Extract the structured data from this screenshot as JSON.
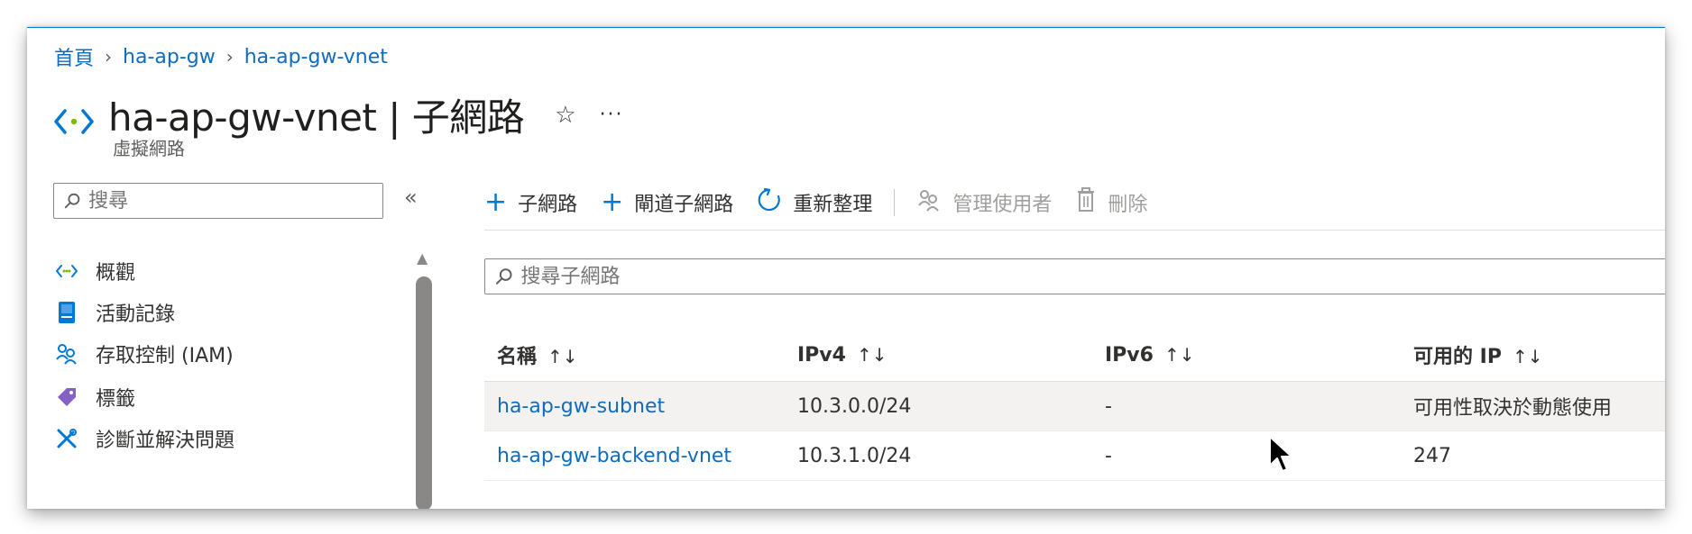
{
  "breadcrumb": {
    "home": "首頁",
    "parent": "ha-ap-gw",
    "current": "ha-ap-gw-vnet"
  },
  "header": {
    "title": "ha-ap-gw-vnet | 子網路",
    "subtitle": "虛擬網路",
    "favorite_icon": "☆",
    "more_icon": "···"
  },
  "sidebar": {
    "search_placeholder": "搜尋",
    "collapse_icon": "«",
    "items": [
      {
        "label": "概觀",
        "icon": "vnet-icon"
      },
      {
        "label": "活動記錄",
        "icon": "activity-log-icon"
      },
      {
        "label": "存取控制 (IAM)",
        "icon": "iam-icon"
      },
      {
        "label": "標籤",
        "icon": "tag-icon"
      },
      {
        "label": "診斷並解決問題",
        "icon": "diagnose-icon"
      }
    ]
  },
  "toolbar": {
    "add_subnet": "子網路",
    "add_gateway_subnet": "閘道子網路",
    "refresh": "重新整理",
    "manage_users": "管理使用者",
    "delete": "刪除"
  },
  "grid": {
    "search_placeholder": "搜尋子網路",
    "columns": [
      "名稱",
      "IPv4",
      "IPv6",
      "可用的 IP"
    ],
    "sort_glyph": "↑↓",
    "rows": [
      {
        "name": "ha-ap-gw-subnet",
        "ipv4": "10.3.0.0/24",
        "ipv6": "-",
        "available_ips": "可用性取決於動態使用"
      },
      {
        "name": "ha-ap-gw-backend-vnet",
        "ipv4": "10.3.1.0/24",
        "ipv6": "-",
        "available_ips": "247"
      }
    ]
  },
  "colors": {
    "accent": "#0078d4",
    "link": "#0f6cbd",
    "vnet_green": "#7fba00",
    "tag_purple": "#8661c5"
  }
}
